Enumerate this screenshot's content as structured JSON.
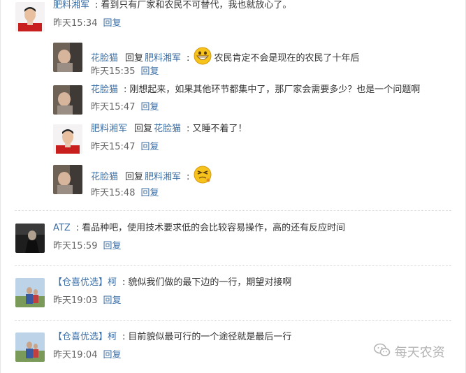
{
  "colors": {
    "link": "#3a6ea5",
    "text": "#333333",
    "time": "#666666",
    "divider": "#dedede"
  },
  "comments": [
    {
      "user": "肥料湘军",
      "text": "看到只有厂家和农民不可替代，我也就放心了。",
      "time": "昨天15:34",
      "reply": "回复"
    },
    {
      "user": "花脸猫",
      "reply_word": "回复",
      "reply_to": "肥料湘军",
      "emoji": "grin-emoji",
      "text": "农民肯定不会是现在的农民了十年后",
      "time": "昨天15:35",
      "reply": "回复"
    },
    {
      "user": "花脸猫",
      "text": "刚想起来，如果其他环节都集中了，那厂家会需要多少？也是一个问题啊",
      "time": "昨天15:47",
      "reply": "回复"
    },
    {
      "user": "肥料湘军",
      "reply_word": "回复",
      "reply_to": "花脸猫",
      "text": "又睡不着了！",
      "time": "昨天15:47",
      "reply": "回复"
    },
    {
      "user": "花脸猫",
      "reply_word": "回复",
      "reply_to": "肥料湘军",
      "emoji": "squint-emoji",
      "text": "",
      "time": "昨天15:48",
      "reply": "回复"
    },
    {
      "user": "ATZ",
      "text": "看品种吧，使用技术要求低的会比较容易操作，高的还有反应时间",
      "time": "昨天15:59",
      "reply": "回复"
    },
    {
      "user": "【仓喜优选】柯",
      "text": "貌似我们做的最下边的一行，期望对接啊",
      "time": "昨天19:03",
      "reply": "回复"
    },
    {
      "user": "【仓喜优选】柯",
      "text": "目前貌似最可行的一个途径就是最后一行",
      "time": "昨天19:04",
      "reply": "回复"
    }
  ],
  "watermark": {
    "icon": "wechat-icon",
    "text": "每天农资"
  }
}
